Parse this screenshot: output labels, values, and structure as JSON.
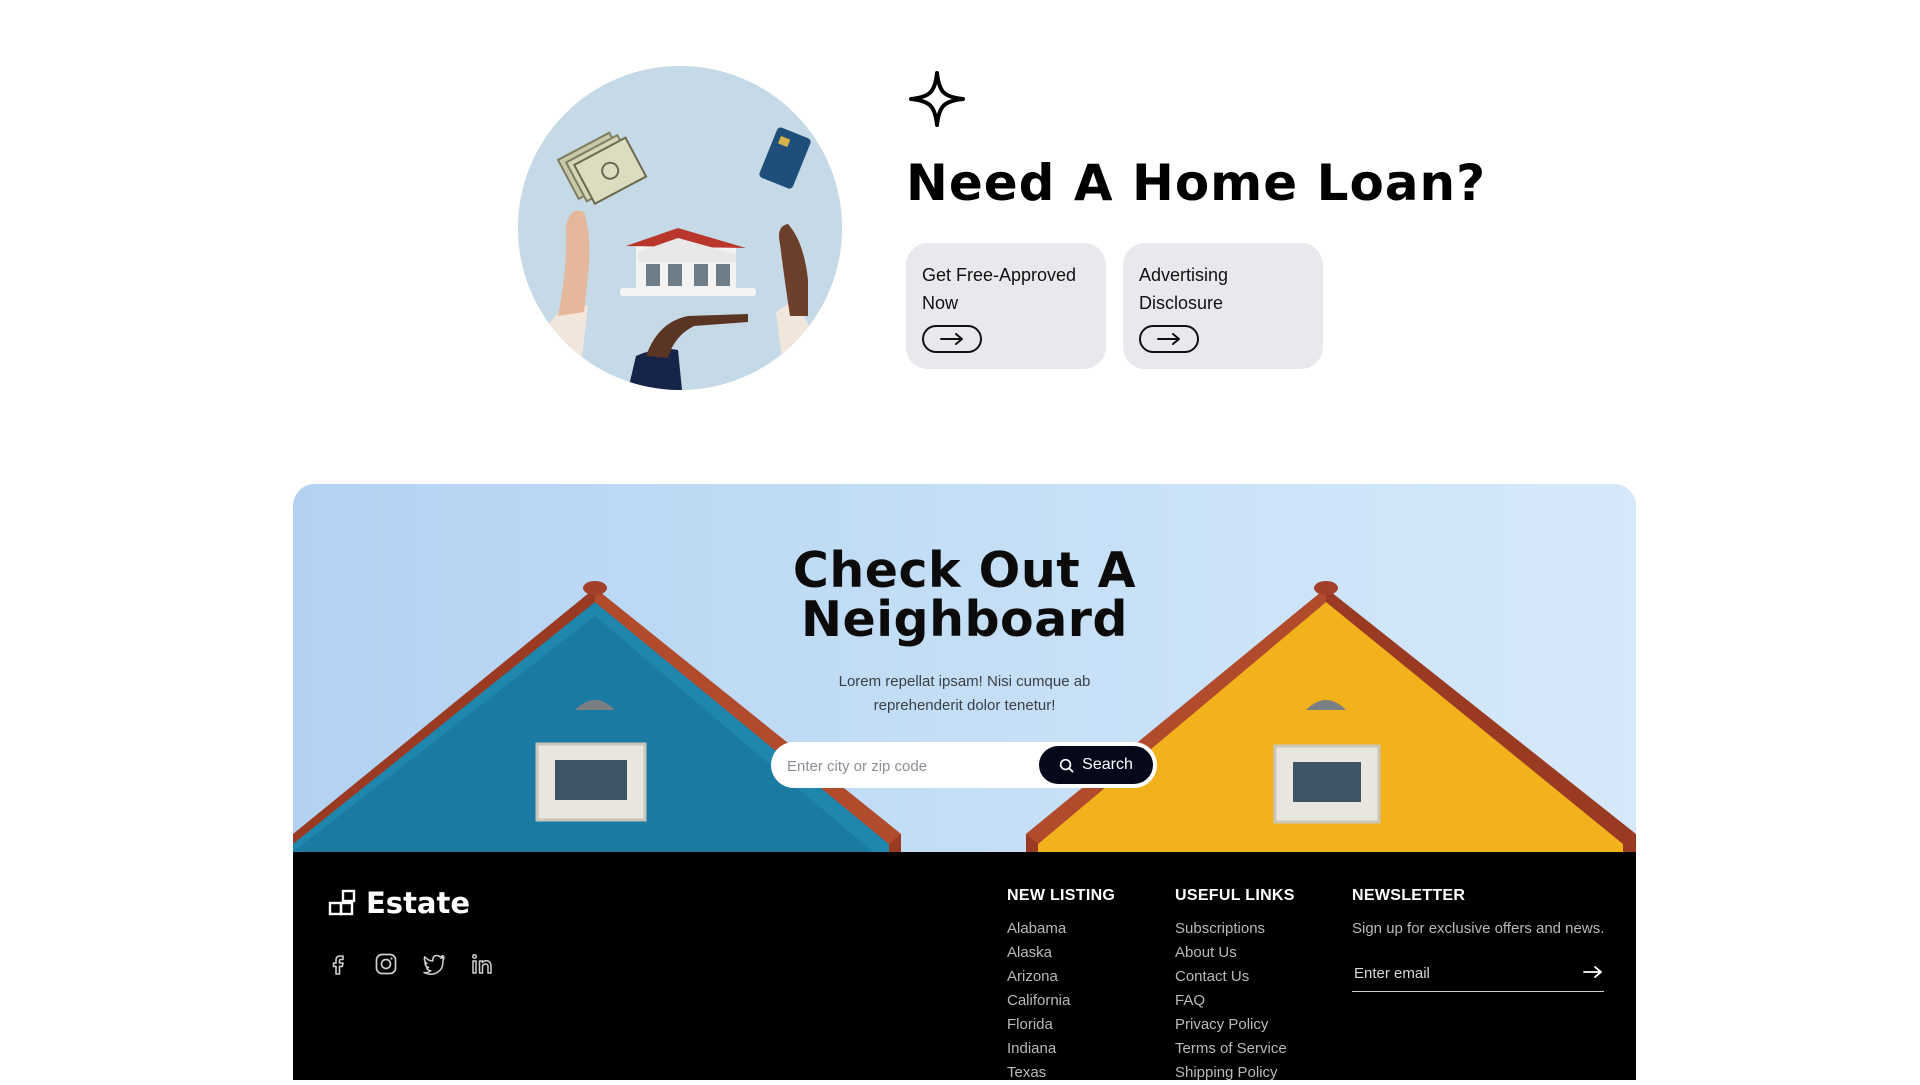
{
  "loan": {
    "title": "Need A Home Loan?",
    "cards": [
      {
        "label": "Get Free-Approved Now",
        "button_icon": "arrow-right-icon"
      },
      {
        "label": "Advertising Disclosure",
        "button_icon": "arrow-right-icon"
      }
    ],
    "sparkle_icon": "sparkle-icon"
  },
  "neighborhood": {
    "title_line1": "Check Out A",
    "title_line2": "Neighboard",
    "subtitle": "Lorem repellat ipsam! Nisi cumque ab reprehenderit dolor tenetur!",
    "search": {
      "placeholder": "Enter city or zip code",
      "button_label": "Search",
      "button_icon": "search-icon"
    }
  },
  "footer": {
    "brand": "Estate",
    "socials": [
      "facebook-icon",
      "instagram-icon",
      "twitter-icon",
      "linkedin-icon"
    ],
    "new_listing": {
      "heading": "NEW LISTING",
      "items": [
        "Alabama",
        "Alaska",
        "Arizona",
        "California",
        "Florida",
        "Indiana",
        "Texas"
      ]
    },
    "useful_links": {
      "heading": "USEFUL LINKS",
      "items": [
        "Subscriptions",
        "About Us",
        "Contact Us",
        "FAQ",
        "Privacy Policy",
        "Terms of Service",
        "Shipping Policy"
      ]
    },
    "newsletter": {
      "heading": "NEWSLETTER",
      "text": "Sign up for exclusive offers and news.",
      "placeholder": "Enter email"
    }
  },
  "colors": {
    "card_bg": "#e8e9ec",
    "search_button": "#05091a",
    "footer_bg": "#000000",
    "house_blue": "#1e7fa6",
    "house_yellow": "#f2b21c",
    "roof_red": "#9a3a22"
  }
}
